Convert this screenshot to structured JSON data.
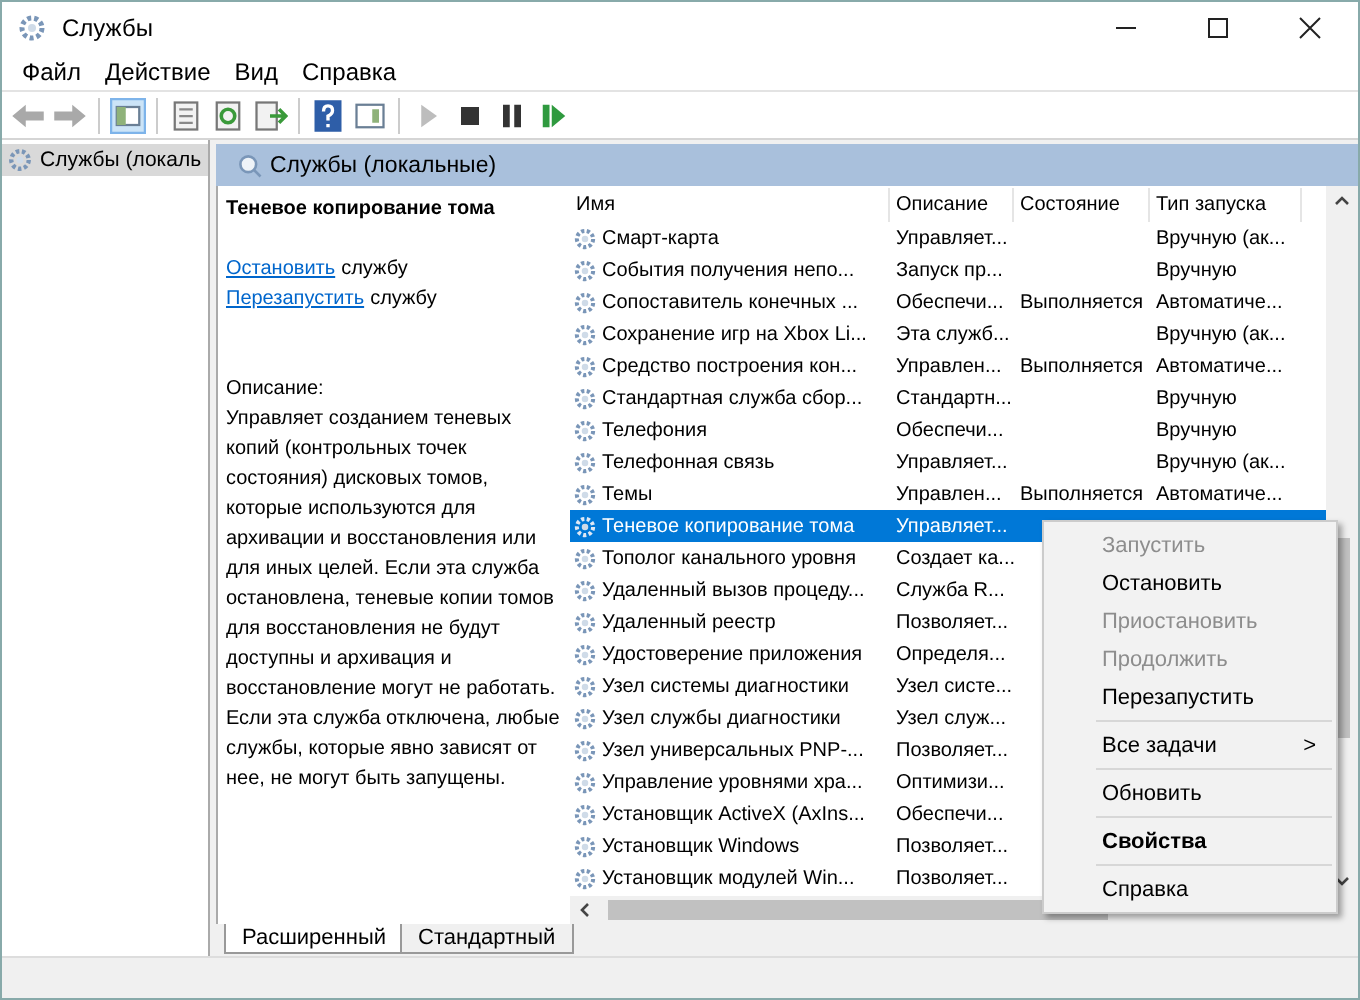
{
  "window": {
    "title": "Службы"
  },
  "menu": [
    "Файл",
    "Действие",
    "Вид",
    "Справка"
  ],
  "toolbar": [
    {
      "kind": "back",
      "disabled": true
    },
    {
      "kind": "forward",
      "disabled": true
    },
    {
      "kind": "sep"
    },
    {
      "kind": "tree",
      "selected": true
    },
    {
      "kind": "sep"
    },
    {
      "kind": "list",
      "disabled": false
    },
    {
      "kind": "refresh",
      "disabled": false
    },
    {
      "kind": "export",
      "disabled": false
    },
    {
      "kind": "sep"
    },
    {
      "kind": "help",
      "disabled": false
    },
    {
      "kind": "pane",
      "disabled": false
    },
    {
      "kind": "sep"
    },
    {
      "kind": "play",
      "disabled": true
    },
    {
      "kind": "stop",
      "disabled": false
    },
    {
      "kind": "pause",
      "disabled": false
    },
    {
      "kind": "restart",
      "disabled": false
    }
  ],
  "tree": {
    "items": [
      {
        "label": "Службы (локаль",
        "selected": true
      }
    ]
  },
  "header": {
    "title": "Службы (локальные)"
  },
  "details": {
    "title": "Теневое копирование тома",
    "actions": [
      {
        "link": "Остановить",
        "text": "службу"
      },
      {
        "link": "Перезапустить",
        "text": "службу"
      }
    ],
    "description_label": "Описание:",
    "description": "Управляет созданием теневых копий (контрольных точек состояния) дисковых томов, которые используются для архивации и восстановления или для иных целей. Если эта служба остановлена, теневые копии томов для восстановления не будут доступны и архивация и восстановление могут не работать. Если эта служба отключена, любые службы, которые явно зависят от нее, не могут быть запущены."
  },
  "table": {
    "columns": [
      "Имя",
      "Описание",
      "Состояние",
      "Тип запуска"
    ],
    "rows": [
      {
        "name": "Смарт-карта",
        "description": "Управляет...",
        "startup": "Вручную (ак...",
        "selected": false
      },
      {
        "name": "События получения непо...",
        "description": "Запуск пр...",
        "startup": "Вручную",
        "selected": false
      },
      {
        "name": "Сопоставитель конечных ...",
        "description": "Обеспечи...",
        "state": "Выполняется",
        "startup": "Автоматиче...",
        "selected": false
      },
      {
        "name": "Сохранение игр на Xbox Li...",
        "description": "Эта служб...",
        "startup": "Вручную (ак...",
        "selected": false
      },
      {
        "name": "Средство построения кон...",
        "description": "Управлен...",
        "state": "Выполняется",
        "startup": "Автоматиче...",
        "selected": false
      },
      {
        "name": "Стандартная служба сбор...",
        "description": "Стандартн...",
        "startup": "Вручную",
        "selected": false
      },
      {
        "name": "Телефония",
        "description": "Обеспечи...",
        "startup": "Вручную",
        "selected": false
      },
      {
        "name": "Телефонная связь",
        "description": "Управляет...",
        "startup": "Вручную (ак...",
        "selected": false
      },
      {
        "name": "Темы",
        "description": "Управлен...",
        "state": "Выполняется",
        "startup": "Автоматиче...",
        "selected": false
      },
      {
        "name": "Теневое копирование тома",
        "description": "Управляет...",
        "selected": true
      },
      {
        "name": "Тополог канального уровня",
        "description": "Создает ка...",
        "selected": false
      },
      {
        "name": "Удаленный вызов процеду...",
        "description": "Служба R...",
        "selected": false
      },
      {
        "name": "Удаленный реестр",
        "description": "Позволяет...",
        "selected": false
      },
      {
        "name": "Удостоверение приложения",
        "description": "Определя...",
        "selected": false
      },
      {
        "name": "Узел системы диагностики",
        "description": "Узел систе...",
        "selected": false
      },
      {
        "name": "Узел службы диагностики",
        "description": "Узел служ...",
        "selected": false
      },
      {
        "name": "Узел универсальных PNP-...",
        "description": "Позволяет...",
        "selected": false
      },
      {
        "name": "Управление уровнями хра...",
        "description": "Оптимизи...",
        "selected": false
      },
      {
        "name": "Установщик ActiveX (AxIns...",
        "description": "Обеспечи...",
        "selected": false
      },
      {
        "name": "Установщик Windows",
        "description": "Позволяет...",
        "selected": false
      },
      {
        "name": "Установщик модулей Win...",
        "description": "Позволяет...",
        "selected": false
      }
    ]
  },
  "context_menu": [
    {
      "kind": "item",
      "label": "Запустить",
      "disabled": true
    },
    {
      "kind": "item",
      "label": "Остановить",
      "disabled": false
    },
    {
      "kind": "item",
      "label": "Приостановить",
      "disabled": true
    },
    {
      "kind": "item",
      "label": "Продолжить",
      "disabled": true
    },
    {
      "kind": "item",
      "label": "Перезапустить",
      "disabled": false
    },
    {
      "kind": "separator"
    },
    {
      "kind": "submenu",
      "label": "Все задачи",
      "arrow": ">",
      "disabled": false
    },
    {
      "kind": "separator"
    },
    {
      "kind": "item",
      "label": "Обновить",
      "disabled": false
    },
    {
      "kind": "separator"
    },
    {
      "kind": "default",
      "label": "Свойства",
      "disabled": false
    },
    {
      "kind": "separator"
    },
    {
      "kind": "item",
      "label": "Справка",
      "disabled": false
    }
  ],
  "tabs": [
    {
      "label": "Расширенный",
      "selected": true
    },
    {
      "label": "Стандартный",
      "selected": false
    }
  ]
}
